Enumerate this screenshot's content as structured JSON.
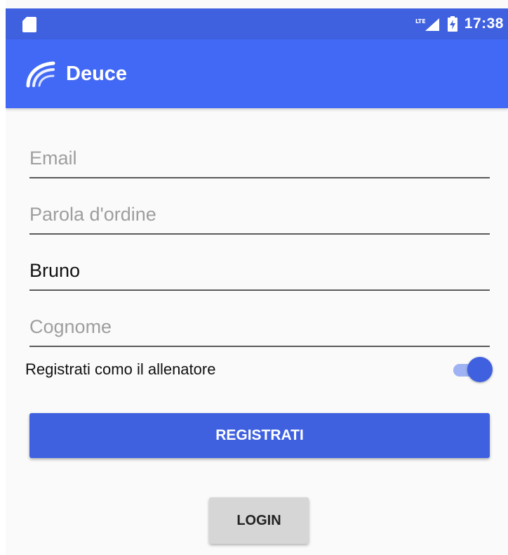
{
  "status_bar": {
    "time": "17:38",
    "network": "LTE",
    "left_icon": "sd-card-icon",
    "signal_icon": "lte-signal-icon",
    "battery_icon": "battery-charging-icon"
  },
  "app_bar": {
    "title": "Deuce",
    "logo_icon": "deuce-logo-icon",
    "color": "#4269f5"
  },
  "form": {
    "email": {
      "value": "",
      "placeholder": "Email"
    },
    "password": {
      "value": "",
      "placeholder": "Parola d'ordine"
    },
    "first_name": {
      "value": "Bruno",
      "placeholder": ""
    },
    "last_name": {
      "value": "",
      "placeholder": "Cognome"
    },
    "coach_switch": {
      "label": "Registrati como il allenatore",
      "checked": true
    }
  },
  "actions": {
    "register_label": "REGISTRATI",
    "login_label": "LOGIN"
  },
  "colors": {
    "accent": "#3f61e0",
    "status_bar": "#3f61e0",
    "background": "#fafafa",
    "switch_track": "#9fb2f3",
    "secondary_button": "#d6d6d6"
  }
}
